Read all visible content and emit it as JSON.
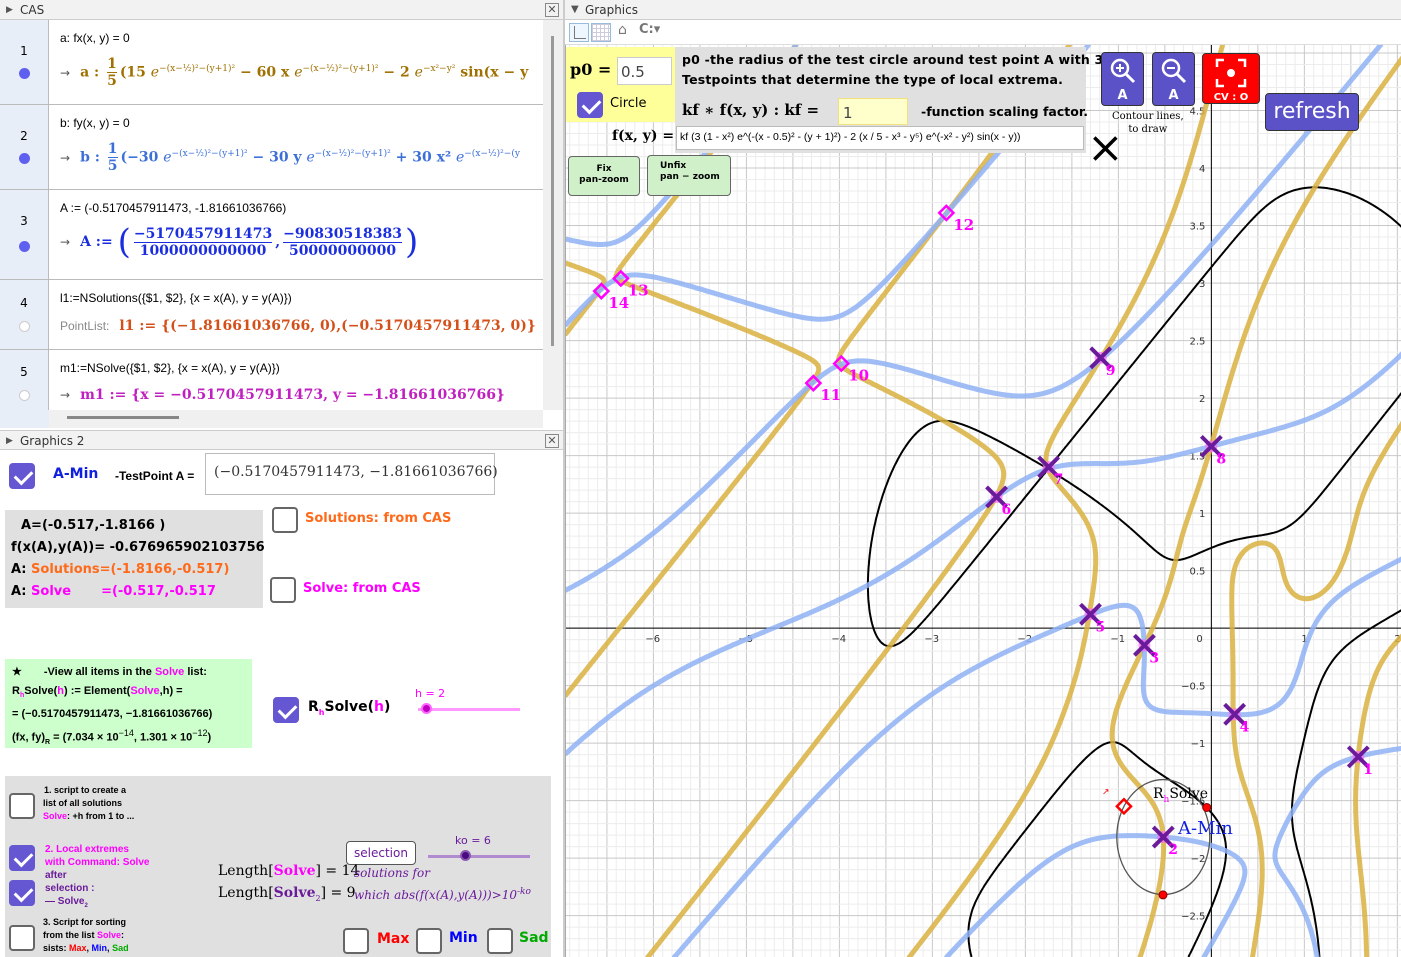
{
  "cas": {
    "title": "CAS",
    "rows": [
      {
        "num": "1",
        "input": "a: fx(x, y) = 0",
        "name": "a :",
        "frac": [
          "1",
          "5"
        ],
        "color": "#a07000",
        "terms": [
          {
            "pre": "(15 ",
            "base": "e",
            "sup": "−(x−½)²−(y+1)²"
          },
          {
            "pre": " − 60 x ",
            "base": "e",
            "sup": "−(x−½)²−(y+1)²"
          },
          {
            "pre": " − 2 ",
            "base": "e",
            "sup": "−x²−y²"
          },
          {
            "pre": " sin(x − y",
            "base": "",
            "sup": ""
          }
        ]
      },
      {
        "num": "2",
        "input": "b: fy(x, y) = 0",
        "name": "b :",
        "frac": [
          "1",
          "5"
        ],
        "color": "#3c6fd8",
        "terms": [
          {
            "pre": "(−30 ",
            "base": "e",
            "sup": "−(x−½)²−(y+1)²"
          },
          {
            "pre": " − 30 y ",
            "base": "e",
            "sup": "−(x−½)²−(y+1)²"
          },
          {
            "pre": " + 30 x² ",
            "base": "e",
            "sup": "−(x−½)²−(y"
          }
        ]
      },
      {
        "num": "3",
        "input": "A := (-0.5170457911473, -1.81661036766)",
        "name": "A :=",
        "fracs": [
          [
            "−5170457911473",
            "1000000000000"
          ],
          [
            "−90830518383",
            "50000000000"
          ]
        ]
      },
      {
        "num": "4",
        "input": "l1:=NSolutions({$1, $2}, {x = x(A), y = y(A)})",
        "prefix": "PointList:",
        "output": "l1 := {(−1.81661036766, 0),(−0.5170457911473, 0)}"
      },
      {
        "num": "5",
        "input": "m1:=NSolve({$1, $2}, {x = x(A), y = y(A)})",
        "output": "m1 := {x = −0.5170457911473, y = −1.81661036766}"
      }
    ]
  },
  "graphics2": {
    "title": "Graphics 2",
    "a_min_label": "A-Min",
    "testpoint_label": "-TestPoint A =",
    "testpoint_value": "(−0.5170457911473, −1.81661036766)",
    "info": {
      "line1": "A=(-0.517,-1.8166  )",
      "line2": "f(x(A),y(A))= -0.676965902103756",
      "line3_pre": "A: ",
      "line3": "Solutions=(-1.8166,-0.517)",
      "line4_pre": "A: ",
      "line4_a": "Solve",
      "line4_b": "=(-0.517,-0.517"
    },
    "solutions_cas": "Solutions: from CAS",
    "solve_cas": "Solve: from CAS",
    "green": {
      "star": "★",
      "title_pre": "-View all items in the ",
      "title_mid": "Solve",
      "title_post": " list:",
      "l1a": "R",
      "l1b": "Solve(",
      "l1c": "h",
      "l1d": ") := Element(",
      "l1e": "Solve",
      "l1f": ",h) =",
      "l2": "= (−0.5170457911473,  −1.81661036766)",
      "l3": "(fx, fy)",
      "l3b": "R",
      "l3c": " = (7.034 × 10",
      "l3d": "−14",
      "l3e": ", 1.301 × 10",
      "l3f": "−12",
      "l3g": ")"
    },
    "rh_solve": {
      "r": "R",
      "h": "h",
      "solve": "Solve(",
      "arg": "h",
      "close": ")",
      "checked": true
    },
    "h_slider": {
      "label": "h = 2",
      "value": 2,
      "min": 1,
      "max": 14
    },
    "script1": {
      "l1": "1. script to create a",
      "l2": "list of all solutions",
      "l3a": "Solve",
      "l3b": ": +h from 1 to ...",
      "checked": false
    },
    "script2": {
      "l1": "2. Local extremes",
      "l2": "with Command: Solve",
      "l3": "after",
      "l4": "selection :",
      "l5": "— Solve",
      "l5sub": "2",
      "checked": true,
      "checked2": true
    },
    "script3": {
      "l1": "3. Script for sorting",
      "l2a": "from the list ",
      "l2b": "Solve",
      "l2c": ":",
      "l3a": "sists: ",
      "max": "Max",
      "min": "Min",
      "sad": "Sad",
      "checked": false
    },
    "selection_button": "selection",
    "ko_slider": {
      "label": "ko = 6",
      "value": 6,
      "min": 1,
      "max": 15
    },
    "length1": {
      "a": "Length[",
      "b": "Solve",
      "c": "] = 14"
    },
    "length2": {
      "a": "Length[",
      "b": "Solve",
      "sub": "2",
      "c": "] = 9"
    },
    "note1": "solutions for",
    "note2": "which abs(f(x(A),y(A)))>10",
    "note2sup": "-ko",
    "max_label": "Max",
    "min_label": "Min",
    "sad_label": "Sad"
  },
  "graphics": {
    "title": "Graphics",
    "p0_label": "p0 =",
    "p0_value": "0.5",
    "circle_label": "Circle",
    "desc1": "p0  -the radius of the test circle around test point A with 3",
    "desc2": "Testpoints that determine the type of local extrema.",
    "kf_label": "kf ∗ f(x, y) :   kf =",
    "kf_value": "1",
    "kf_desc": "-function scaling factor.",
    "f_label": "f(x, y) =",
    "f_value": "kf (3 (1 - x²) e^(-(x - 0.5)² - (y + 1)²) - 2 (x / 5 - x³ - y⁵) e^(-x² - y²) sin(x - y))",
    "fix_button": [
      "Fix",
      "pan-zoom"
    ],
    "unfix_button": [
      "Unfix",
      "pan − zoom"
    ],
    "zoom_in": "A",
    "zoom_out": "A",
    "cv_label": "CV : O",
    "refresh": "refresh",
    "contour_note": [
      "Contour lines,",
      "to draw"
    ],
    "rh_solve_label": "Solve",
    "a_min_label": "A-Min"
  },
  "chart_data": {
    "type": "scatter",
    "xlim": [
      -6.94,
      2.05
    ],
    "ylim": [
      -2.86,
      5.07
    ],
    "x_ticks": [
      -6,
      -5,
      -4,
      -3,
      -2,
      -1,
      0,
      1,
      2
    ],
    "y_ticks": [
      -2.5,
      -2,
      -1.5,
      -1,
      -0.5,
      0.5,
      1,
      1.5,
      2,
      2.5,
      3,
      3.5,
      4,
      4.5
    ],
    "grid": true,
    "curves": [
      {
        "name": "a",
        "equation": "fx(x, y) = 0",
        "color": "#d9b040"
      },
      {
        "name": "b",
        "equation": "fy(x, y) = 0",
        "color": "#8fb2f4"
      }
    ],
    "contour_color": "#000000",
    "solve2_points": [
      {
        "label": "1",
        "x": 1.58,
        "y": -1.12
      },
      {
        "label": "2",
        "x": -0.517,
        "y": -1.817
      },
      {
        "label": "3",
        "x": -0.72,
        "y": -0.15
      },
      {
        "label": "4",
        "x": 0.25,
        "y": -0.75
      },
      {
        "label": "5",
        "x": -1.3,
        "y": 0.12
      },
      {
        "label": "6",
        "x": -2.31,
        "y": 1.14
      },
      {
        "label": "7",
        "x": -1.75,
        "y": 1.4
      },
      {
        "label": "8",
        "x": 0.0,
        "y": 1.58
      },
      {
        "label": "9",
        "x": -1.19,
        "y": 2.35
      }
    ],
    "other_points": [
      {
        "label": "10",
        "x": -3.98,
        "y": 2.3
      },
      {
        "label": "11",
        "x": -4.28,
        "y": 2.13
      },
      {
        "label": "12",
        "x": -2.85,
        "y": 3.61
      },
      {
        "label": "13",
        "x": -6.35,
        "y": 3.04
      },
      {
        "label": "14",
        "x": -6.56,
        "y": 2.93
      }
    ],
    "black_cross": {
      "x": -1.14,
      "y": 4.17
    },
    "test_circle": {
      "center": [
        -0.517,
        -1.817
      ],
      "radius": 0.5
    },
    "test_points": [
      {
        "x": -0.05,
        "y": -1.56
      },
      {
        "x": -0.52,
        "y": -2.32
      }
    ],
    "red_diamond": {
      "x": -0.94,
      "y": -1.55
    },
    "colors": {
      "solve2": "#6a1b9a",
      "label": "#ff00ff",
      "testpoint": "#ff0000"
    }
  }
}
